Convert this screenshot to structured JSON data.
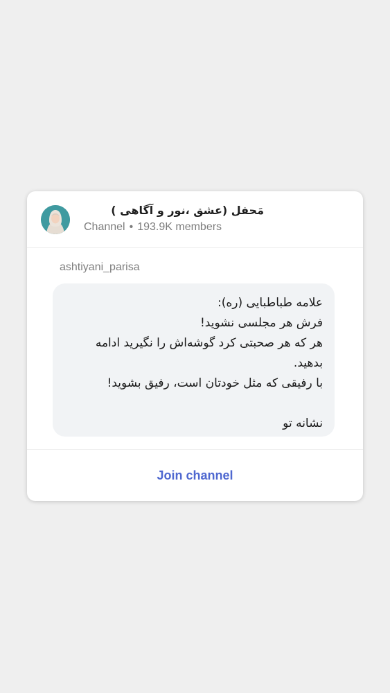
{
  "channel": {
    "title": "مَحفل   (عشق ،نور و آگاهی   )",
    "type_label": "Channel",
    "separator": "•",
    "members": "193.9K members",
    "avatar": "channel-avatar-portrait"
  },
  "post": {
    "author": "ashtiyani_parisa",
    "lines": [
      "علامه طباطبایی (ره):",
      "فرش هر مجلسی نشوید!",
      "هر که هر صحبتی کرد گوشه‌اش را نگیرید ادامه",
      "بدهید.",
      "با رفیقی که مثل خودتان است، رفیق بشوید!",
      "",
      "نشانه تو"
    ]
  },
  "footer": {
    "join_label": "Join channel"
  },
  "colors": {
    "accent": "#4f68d0",
    "bubble": "#f1f3f5",
    "background": "#efefef"
  }
}
